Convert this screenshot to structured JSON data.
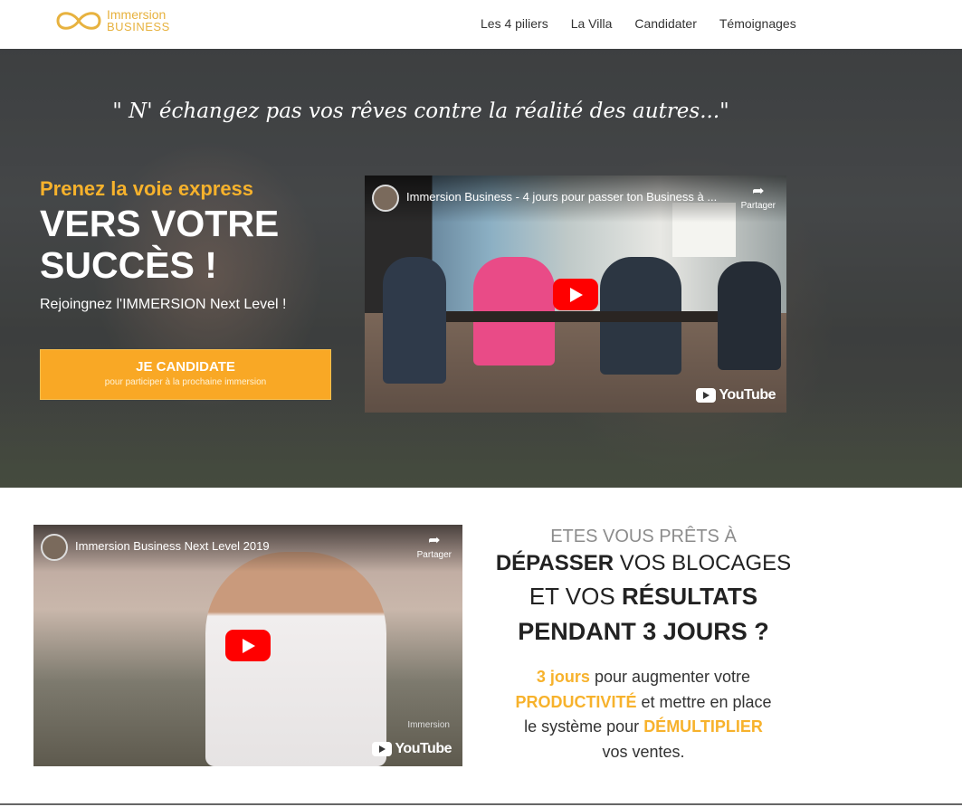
{
  "header": {
    "logo": {
      "line1": "Immersion",
      "line2": "BUSINESS",
      "brand_color": "#e7b23f"
    },
    "nav": [
      "Les 4 piliers",
      "La Villa",
      "Candidater",
      "Témoignages"
    ]
  },
  "hero": {
    "quote": "\" N' échangez pas vos rêves contre la réalité des autres...\"",
    "express": "Prenez la voie express",
    "headline_line1": "VERS VOTRE",
    "headline_line2": "SUCCÈS !",
    "subtext": "Rejoingnez l'IMMERSION Next Level !",
    "cta": {
      "label": "JE CANDIDATE",
      "sublabel": "pour participer à la prochaine immersion",
      "color": "#f9a825"
    },
    "video": {
      "title": "Immersion Business - 4 jours pour passer ton Business à ...",
      "share_label": "Partager",
      "brand": "YouTube"
    }
  },
  "section2": {
    "video": {
      "title": "Immersion Business Next Level 2019",
      "share_label": "Partager",
      "brand": "YouTube",
      "watermark": "Immersion"
    },
    "pitch": {
      "line1": "ETES VOUS PRÊTS À",
      "line2_bold": "DÉPASSER",
      "line2_rest": " VOS BLOCAGES",
      "line3_pre": "ET VOS ",
      "line3_bold": "RÉSULTATS",
      "line4": "PENDANT 3 JOURS ?",
      "body_hl1": "3 jours",
      "body_t1": " pour augmenter votre",
      "body_hl2": "PRODUCTIVITÉ",
      "body_t2": " et mettre en place",
      "body_t3": "le système pour ",
      "body_hl3": "DÉMULTIPLIER",
      "body_t4": "vos ventes.",
      "accent_color": "#f7b22c"
    }
  }
}
